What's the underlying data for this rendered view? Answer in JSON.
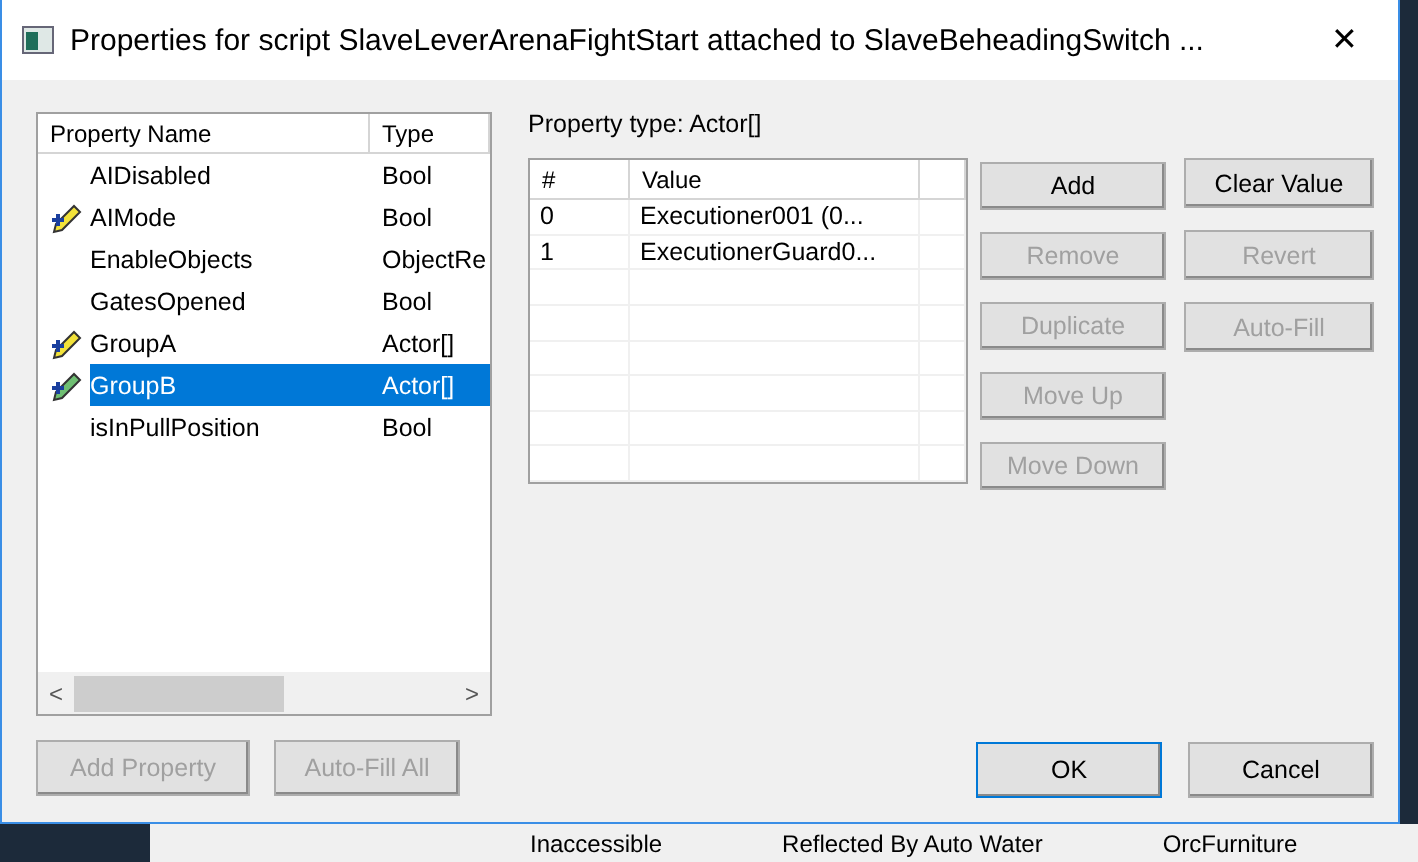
{
  "window": {
    "title": "Properties for script SlaveLeverArenaFightStart attached to SlaveBeheadingSwitch ...",
    "close": "✕"
  },
  "property_list": {
    "columns": [
      "Property Name",
      "Type"
    ],
    "rows": [
      {
        "name": "AIDisabled",
        "type": "Bool",
        "flagged": false,
        "selected": false
      },
      {
        "name": "AIMode",
        "type": "Bool",
        "flagged": true,
        "selected": false
      },
      {
        "name": "EnableObjects",
        "type": "ObjectRe",
        "flagged": false,
        "selected": false
      },
      {
        "name": "GatesOpened",
        "type": "Bool",
        "flagged": false,
        "selected": false
      },
      {
        "name": "GroupA",
        "type": "Actor[]",
        "flagged": true,
        "selected": false
      },
      {
        "name": "GroupB",
        "type": "Actor[]",
        "flagged": true,
        "selected": true
      },
      {
        "name": "isInPullPosition",
        "type": "Bool",
        "flagged": false,
        "selected": false
      }
    ],
    "scroll": {
      "left": "<",
      "right": ">"
    }
  },
  "list_buttons": [
    {
      "label": "Add Property",
      "disabled": true
    },
    {
      "label": "Auto-Fill All",
      "disabled": true
    }
  ],
  "property_type": "Property type: Actor[]",
  "value_table": {
    "columns": [
      "#",
      "Value"
    ],
    "rows": [
      {
        "index": "0",
        "value": "Executioner001 (0..."
      },
      {
        "index": "1",
        "value": "ExecutionerGuard0..."
      }
    ]
  },
  "array_buttons": [
    {
      "label": "Add",
      "disabled": false
    },
    {
      "label": "Remove",
      "disabled": true
    },
    {
      "label": "Duplicate",
      "disabled": true
    },
    {
      "label": "Move Up",
      "disabled": true
    },
    {
      "label": "Move Down",
      "disabled": true
    }
  ],
  "value_buttons": [
    {
      "label": "Clear Value",
      "disabled": false
    },
    {
      "label": "Revert",
      "disabled": true
    },
    {
      "label": "Auto-Fill",
      "disabled": true
    }
  ],
  "dialog_buttons": [
    {
      "label": "OK",
      "disabled": false,
      "default": true
    },
    {
      "label": "Cancel",
      "disabled": false,
      "default": false
    }
  ],
  "background_window": {
    "items": [
      "Inaccessible",
      "Reflected By Auto Water",
      "OrcFurniture"
    ]
  }
}
